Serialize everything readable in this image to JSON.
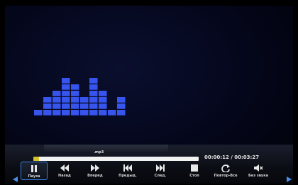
{
  "track": {
    "title": ".mp3",
    "elapsed": "00:00:12",
    "total": "00:03:27",
    "time_display": "00:00:12 / 00:03:27",
    "progress": 0.034
  },
  "visualizer": {
    "levels": [
      1,
      3,
      4,
      6,
      5,
      3,
      6,
      4,
      1,
      3
    ],
    "bar_color": "#3c5bff"
  },
  "controls": [
    {
      "id": "pause",
      "label": "Пауза",
      "icon": "pause-icon",
      "selected": true
    },
    {
      "id": "rewind",
      "label": "Назад",
      "icon": "rewind-icon",
      "selected": false
    },
    {
      "id": "forward",
      "label": "Вперед",
      "icon": "fast-forward-icon",
      "selected": false
    },
    {
      "id": "previous",
      "label": "Предыд.",
      "icon": "skip-previous-icon",
      "selected": false
    },
    {
      "id": "next",
      "label": "След.",
      "icon": "skip-next-icon",
      "selected": false
    },
    {
      "id": "stop",
      "label": "Стоп",
      "icon": "stop-icon",
      "selected": false
    },
    {
      "id": "repeat",
      "label": "Повтор-Все",
      "icon": "repeat-icon",
      "selected": false
    },
    {
      "id": "mute",
      "label": "Без звука",
      "icon": "mute-icon",
      "selected": false
    }
  ],
  "colors": {
    "accent": "#3a7fe0",
    "progress_fill": "#d7c22c",
    "progress_track": "#f2f2f2",
    "nav_arrow": "#4a8fe8"
  }
}
